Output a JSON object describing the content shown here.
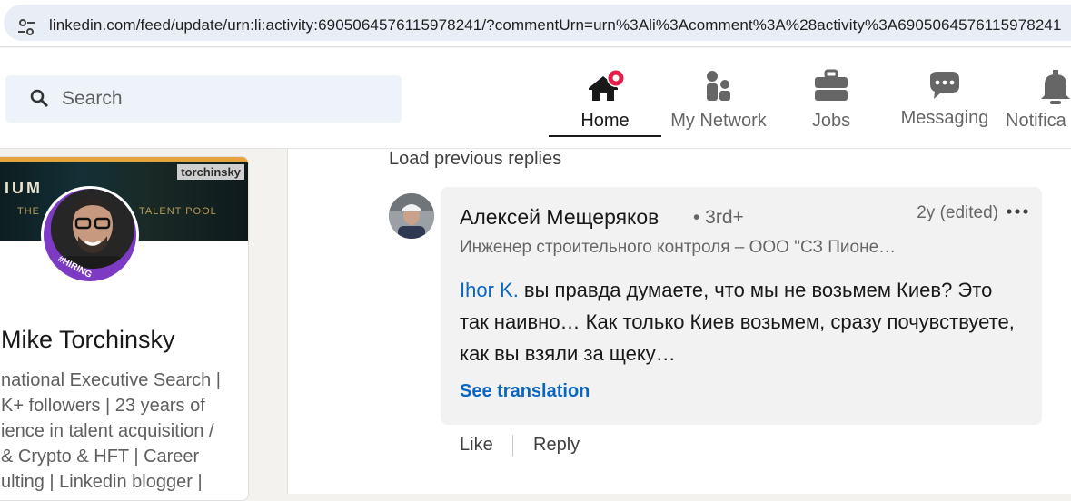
{
  "browser": {
    "url": "linkedin.com/feed/update/urn:li:activity:6905064576115978241/?commentUrn=urn%3Ali%3Acomment%3A%28activity%3A6905064576115978241"
  },
  "header": {
    "search_placeholder": "Search",
    "nav": [
      {
        "label": "Home",
        "icon": "home-icon",
        "active": true
      },
      {
        "label": "My Network",
        "icon": "network-icon"
      },
      {
        "label": "Jobs",
        "icon": "briefcase-icon"
      },
      {
        "label": "Messaging",
        "icon": "chat-icon"
      },
      {
        "label": "Notifica",
        "icon": "bell-icon"
      }
    ],
    "accent": "#e2204b"
  },
  "profile": {
    "banner_text1": "IUM",
    "banner_text2": "THE",
    "banner_text3": "TALENT POOL",
    "banner_tag": "torchinsky",
    "avatar_badge": "#HIRING",
    "name": "Mike Torchinsky",
    "headline": "national Executive Search |\nK+ followers | 23 years of\nience in talent acquisition /\n& Crypto & HFT | Career\nulting | Linkedin blogger |"
  },
  "feed": {
    "load_previous": "Load previous replies",
    "comment": {
      "author": "Алексей Мещеряков",
      "degree": "• 3rd+",
      "time": "2y (edited)",
      "subtitle": "Инженер строительного контроля – ООО \"СЗ Пионе…",
      "mention": "Ihor K.",
      "text": " вы правда думаете, что мы не возьмем Киев? Это так наивно… Как только Киев возьмем, сразу почувствуете, как вы взяли за щеку…",
      "see_translation": "See translation"
    },
    "actions": {
      "like": "Like",
      "reply": "Reply"
    }
  },
  "colors": {
    "link_blue": "#0a66c2",
    "search_bg": "#edf3f8",
    "page_bg": "#f4f2ee"
  }
}
